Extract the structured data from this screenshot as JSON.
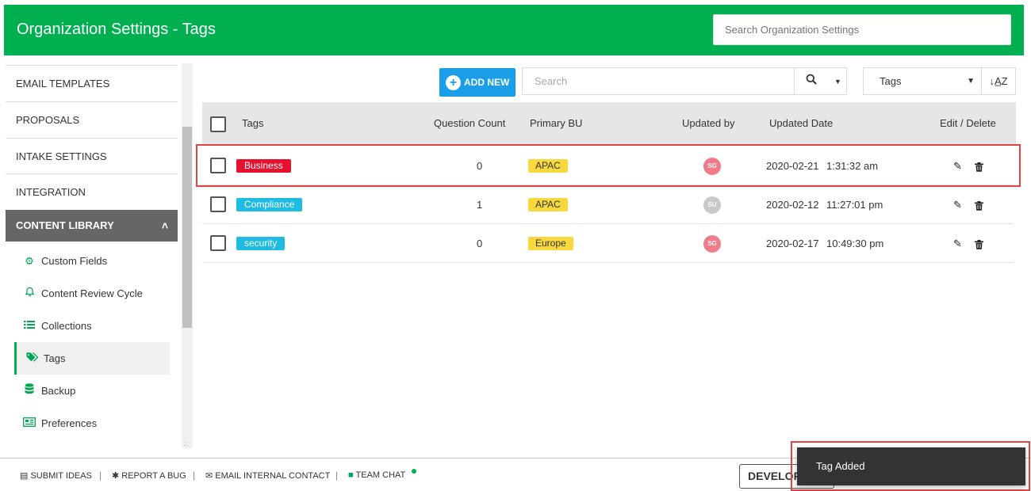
{
  "header": {
    "title": "Organization Settings - Tags",
    "search_placeholder": "Search Organization Settings"
  },
  "sidebar": {
    "items": [
      {
        "label": "EMAIL TEMPLATES"
      },
      {
        "label": "PROPOSALS"
      },
      {
        "label": "INTAKE SETTINGS"
      },
      {
        "label": "INTEGRATION"
      }
    ],
    "section": {
      "label": "CONTENT LIBRARY",
      "icon": "chevron-up-icon"
    },
    "sub_items": [
      {
        "label": "Custom Fields",
        "icon": "gear-icon"
      },
      {
        "label": "Content Review Cycle",
        "icon": "bell-icon"
      },
      {
        "label": "Collections",
        "icon": "list-icon"
      },
      {
        "label": "Tags",
        "icon": "tags-icon",
        "active": true
      },
      {
        "label": "Backup",
        "icon": "database-icon"
      },
      {
        "label": "Preferences",
        "icon": "newspaper-icon"
      }
    ]
  },
  "toolbar": {
    "add_new_label": "ADD NEW",
    "search_placeholder": "Search",
    "filter_value": "Tags",
    "sort_label": "↓A̲Z"
  },
  "table": {
    "columns": [
      "Tags",
      "Question Count",
      "Primary BU",
      "Updated by",
      "Updated Date",
      "Edit / Delete"
    ],
    "rows": [
      {
        "tag": "Business",
        "tag_color": "#e8102e",
        "count": "0",
        "bu": "APAC",
        "updated_by": "SG",
        "avatar_color": "#f27b8a",
        "date": "2020-02-21",
        "time": "1:31:32 am"
      },
      {
        "tag": "Compliance",
        "tag_color": "#1ebce3",
        "count": "1",
        "bu": "APAC",
        "updated_by": "SU",
        "avatar_color": "#c9c9c9",
        "date": "2020-02-12",
        "time": "11:27:01 pm"
      },
      {
        "tag": "security",
        "tag_color": "#1ebce3",
        "count": "0",
        "bu": "Europe",
        "updated_by": "SG",
        "avatar_color": "#f27b8a",
        "date": "2020-02-17",
        "time": "10:49:30 pm"
      }
    ]
  },
  "footer": {
    "submit_ideas": "SUBMIT IDEAS",
    "report_bug": "REPORT A BUG",
    "email_contact": "EMAIL INTERNAL CONTACT",
    "team_chat": "TEAM CHAT",
    "separator": "|",
    "developer_button": "DEVELOPER"
  },
  "toast": {
    "message": "Tag Added"
  },
  "colors": {
    "brand_green": "#00b050",
    "accent_blue": "#1a9ee8",
    "highlight_red": "#e04444"
  }
}
